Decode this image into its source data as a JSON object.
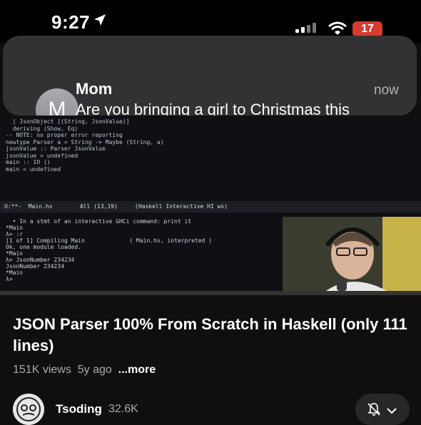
{
  "status_bar": {
    "time": "9:27",
    "battery": "17"
  },
  "notification": {
    "avatar_initial": "M",
    "sender": "Mom",
    "body": "Are you bringing a girl to Christmas this year?",
    "time": "now"
  },
  "video": {
    "code_lines": [
      "  | JsonObject [(String, JsonValue)]",
      "  deriving (Show, Eq)",
      "",
      "-- NOTE: no proper error reporting",
      "newtype Parser a = String -> Maybe (String, a)",
      "",
      "jsonValue :: Parser JsonValue",
      "jsonValue = undefined",
      "",
      "main :: IO ()",
      "main = undefined"
    ],
    "modeline": "U:**-  Main.hs        All (13,19)     (Haskell Interactive HI ws)",
    "ghci_lines": [
      "  • In a stmt of an interactive GHCi command: print it",
      "*Main",
      "λ> :r",
      "[1 of 1] Compiling Main             ( Main.hs, interpreted )",
      "Ok, one module loaded.",
      "*Main",
      "λ> JsonNumber 234234",
      "JsonNumber 234234",
      "*Main",
      "λ> "
    ]
  },
  "title": "JSON Parser 100% From Scratch in Haskell (only 111 lines)",
  "meta": {
    "views": "151K views",
    "age": "5y ago",
    "more": "...more"
  },
  "channel": {
    "name": "Tsoding",
    "subscribers": "32.6K"
  },
  "icons": {
    "location": "location-arrow-icon",
    "signal": "cellular-signal-icon",
    "wifi": "wifi-icon",
    "messages": "messages-app-icon",
    "bell": "bell-off-icon",
    "chevron": "chevron-down-icon"
  },
  "colors": {
    "battery_low": "#d63b2f",
    "messages_green": "#34c759",
    "background": "#0f0f0f"
  }
}
